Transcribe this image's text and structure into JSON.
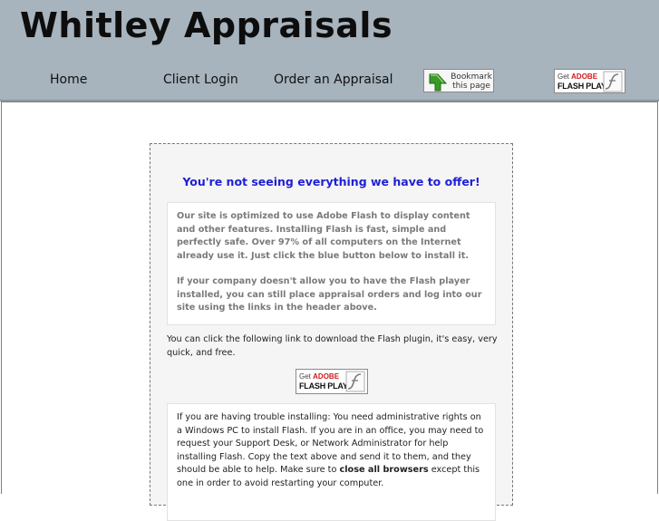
{
  "header": {
    "site_title": "Whitley Appraisals",
    "nav": {
      "home": "Home",
      "client_login": "Client Login",
      "order_appraisal": "Order an Appraisal"
    },
    "bookmark_button": {
      "line1": "Bookmark",
      "line2": "this page",
      "icon": "bookmark-arrow-icon"
    },
    "flash_badge": {
      "get": "Get",
      "adobe": "ADOBE",
      "product": "FLASH PLAYER",
      "icon": "flash-logo-icon"
    }
  },
  "notice": {
    "heading": "You're not seeing everything we have to offer!",
    "info_paragraph_1": "Our site is optimized to use Adobe Flash to display content and other features. Installing Flash is fast, simple and perfectly safe. Over 97% of all computers on the Internet already use it. Just click the blue button below to install it.",
    "info_paragraph_2": "If your company doesn't allow you to have the Flash player installed, you can still place appraisal orders and log into our site using the links in the header above.",
    "download_text": "You can click the following link to download the Flash plugin, it's easy, very quick, and free.",
    "flash_badge": {
      "get": "Get",
      "adobe": "ADOBE",
      "product": "FLASH PLAYER"
    },
    "trouble": {
      "text_before": "If you are having trouble installing: You need administrative rights on a Windows PC to install Flash. If you are in an office, you may need to request your Support Desk, or Network Administrator for help installing Flash. Copy the text above and send it to them, and they should be able to help. Make sure to ",
      "bold": "close all browsers",
      "text_after": " except this one in order to avoid restarting your computer."
    }
  },
  "colors": {
    "header_bg": "#a7b3bd",
    "heading_blue": "#1f1fd6",
    "info_text_gray": "#7a7a7a",
    "adobe_red": "#d21a1a"
  }
}
